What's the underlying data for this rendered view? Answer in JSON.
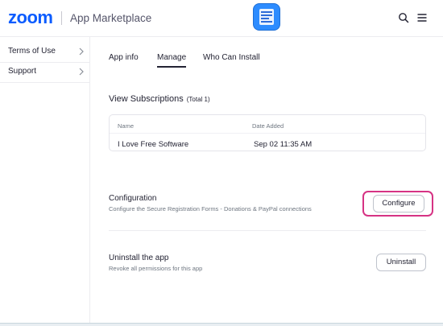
{
  "header": {
    "logo_text": "zoom",
    "brand": "App Marketplace",
    "search_icon": "search-icon",
    "menu_icon": "hamburger-menu-icon",
    "app_icon": "document-app-icon",
    "app_icon_color": "#2d8cff"
  },
  "sidebar": {
    "items": [
      {
        "label": "Terms of Use",
        "icon": "chevron-right-icon"
      },
      {
        "label": "Support",
        "icon": "chevron-right-icon"
      }
    ]
  },
  "tabs": [
    {
      "label": "App info",
      "active": false
    },
    {
      "label": "Manage",
      "active": true
    },
    {
      "label": "Who Can Install",
      "active": false
    }
  ],
  "subscriptions": {
    "title": "View Subscriptions",
    "total": "(Total 1)",
    "columns": [
      "Name",
      "Date Added"
    ],
    "rows": [
      {
        "name": "I Love Free Software",
        "date": "Sep 02 11:35 AM"
      }
    ]
  },
  "configuration": {
    "title": "Configuration",
    "description": "Configure the Secure Registration Forms - Donations & PayPal connections",
    "button_label": "Configure",
    "highlight_color": "#d63384"
  },
  "uninstall": {
    "title": "Uninstall the app",
    "description": "Revoke all permissions for this app",
    "button_label": "Uninstall"
  },
  "colors": {
    "brand_blue": "#0b5cff",
    "text": "#232333",
    "muted": "#6e7680"
  }
}
